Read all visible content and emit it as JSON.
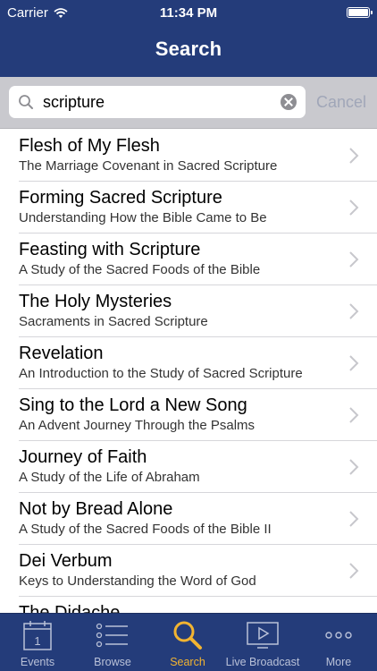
{
  "status_bar": {
    "carrier": "Carrier",
    "time": "11:34 PM"
  },
  "nav": {
    "title": "Search"
  },
  "search": {
    "value": "scripture",
    "cancel_label": "Cancel"
  },
  "results": [
    {
      "title": "Flesh of My Flesh",
      "subtitle": "The Marriage Covenant in Sacred Scripture"
    },
    {
      "title": "Forming Sacred Scripture",
      "subtitle": "Understanding How the Bible Came to Be"
    },
    {
      "title": "Feasting with Scripture",
      "subtitle": "A Study of the Sacred Foods of the Bible"
    },
    {
      "title": "The Holy Mysteries",
      "subtitle": "Sacraments in Sacred Scripture"
    },
    {
      "title": "Revelation",
      "subtitle": "An Introduction to the Study of Sacred Scripture"
    },
    {
      "title": "Sing to the Lord a New Song",
      "subtitle": "An Advent Journey Through the Psalms"
    },
    {
      "title": "Journey of Faith",
      "subtitle": "A Study of the Life of Abraham"
    },
    {
      "title": "Not by Bread Alone",
      "subtitle": "A Study of the Sacred Foods of the Bible II"
    },
    {
      "title": "Dei Verbum",
      "subtitle": "Keys to Understanding the Word of God"
    },
    {
      "title": "The Didache",
      "subtitle": ""
    }
  ],
  "tabs": [
    {
      "label": "Events",
      "icon": "calendar-icon",
      "calendar_day": "1"
    },
    {
      "label": "Browse",
      "icon": "list-icon"
    },
    {
      "label": "Search",
      "icon": "search-icon"
    },
    {
      "label": "Live Broadcast",
      "icon": "play-screen-icon"
    },
    {
      "label": "More",
      "icon": "more-icon"
    }
  ],
  "colors": {
    "bar": "#243c7a",
    "active_tab": "#f2b431",
    "inactive_tab": "#b9c1d8",
    "search_bg": "#c9c9ce"
  }
}
